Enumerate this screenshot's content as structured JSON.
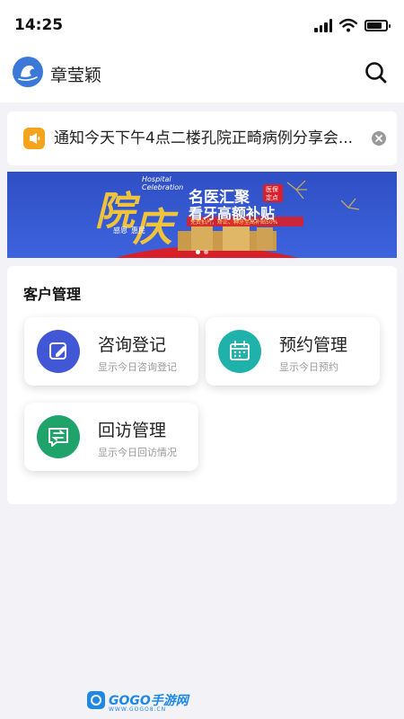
{
  "status": {
    "time": "14:25",
    "battery_level": 0.8
  },
  "header": {
    "title": "章莹颖",
    "logo_icon": "app-logo-icon",
    "search_icon": "search-icon"
  },
  "notice": {
    "icon": "megaphone-icon",
    "text": "通知今天下午4点二楼孔院正畸病例分享会...",
    "close_icon": "close-icon"
  },
  "banner": {
    "hanzi_1": "院",
    "hanzi_2": "庆",
    "english_1": "Hospital",
    "english_2": "Celebration",
    "slogan_1": "感恩",
    "slogan_2": "惠民",
    "headline": "名医汇聚",
    "tag_1": "医保",
    "tag_2": "定点",
    "subheadline": "看牙高额补贴",
    "promo": "免费拍片，矫正、种牙至高补贴50%",
    "slides_total": 2,
    "active_slide": 1
  },
  "customer_management": {
    "title": "客户管理",
    "cards": [
      {
        "title": "咨询登记",
        "subtitle": "显示今日咨询登记",
        "icon": "edit-icon",
        "color": "#4257d6"
      },
      {
        "title": "预约管理",
        "subtitle": "显示今日预约",
        "icon": "calendar-icon",
        "color": "#1fb2ab"
      },
      {
        "title": "回访管理",
        "subtitle": "显示今日回访情况",
        "icon": "exchange-message-icon",
        "color": "#20a36b"
      }
    ]
  },
  "watermark": {
    "text": "GOGO手游网",
    "sub": "WWW.GOGO8.CN"
  }
}
